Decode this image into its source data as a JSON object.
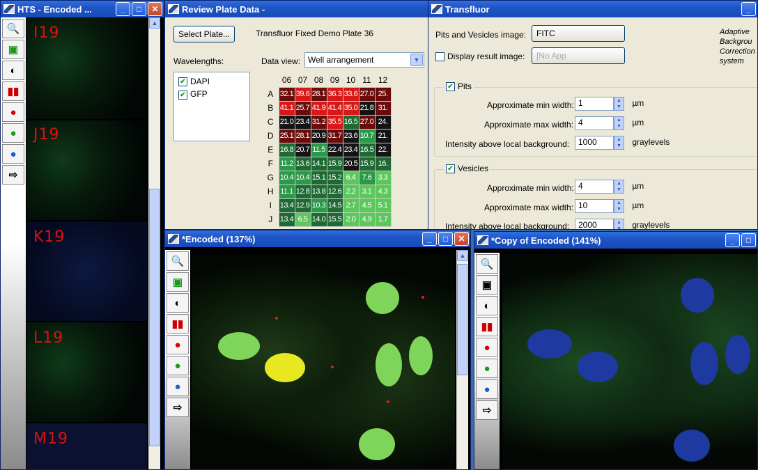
{
  "hts_window": {
    "title": "HTS - Encoded ...",
    "wells": [
      "I19",
      "J19",
      "K19",
      "L19",
      "M19"
    ]
  },
  "review_window": {
    "title": "Review Plate Data -",
    "select_plate_label": "Select Plate...",
    "plate_name": "Transfluor Fixed Demo Plate 36",
    "wavelengths_label": "Wavelengths:",
    "wavelengths": [
      "DAPI",
      "GFP"
    ],
    "data_view_label": "Data view:",
    "data_view_value": "Well arrangement",
    "columns": [
      "06",
      "07",
      "08",
      "09",
      "10",
      "11",
      "12"
    ],
    "rows": [
      {
        "label": "A",
        "values": [
          "32.1",
          "39.6",
          "28.1",
          "36.3",
          "33.6",
          "27.0",
          "25."
        ]
      },
      {
        "label": "B",
        "values": [
          "41.1",
          "25.7",
          "41.9",
          "41.4",
          "35.0",
          "21.8",
          "31."
        ]
      },
      {
        "label": "C",
        "values": [
          "21.0",
          "23.4",
          "31.2",
          "35.5",
          "16.5",
          "27.0",
          "24."
        ]
      },
      {
        "label": "D",
        "values": [
          "25.1",
          "28.1",
          "20.9",
          "31.7",
          "23.6",
          "10.7",
          "21."
        ]
      },
      {
        "label": "E",
        "values": [
          "16.8",
          "20.7",
          "11.5",
          "22.4",
          "23.4",
          "16.5",
          "22."
        ]
      },
      {
        "label": "F",
        "values": [
          "11.2",
          "13.6",
          "14.1",
          "15.9",
          "20.5",
          "15.9",
          "16."
        ]
      },
      {
        "label": "G",
        "values": [
          "10.4",
          "10.4",
          "15.1",
          "15.2",
          "6.4",
          "7.6",
          "3.3"
        ]
      },
      {
        "label": "H",
        "values": [
          "11.1",
          "12.8",
          "13.8",
          "12.6",
          "2.2",
          "3.1",
          "4.3"
        ]
      },
      {
        "label": "I",
        "values": [
          "13.4",
          "12.9",
          "10.3",
          "14.5",
          "2.7",
          "4.5",
          "5.1"
        ]
      },
      {
        "label": "J",
        "values": [
          "13.4",
          "6.5",
          "14.0",
          "15.5",
          "2.0",
          "4.9",
          "1.7"
        ]
      }
    ]
  },
  "transfluor_window": {
    "title": "Transfluor",
    "pits_vesicles_label": "Pits and Vesicles image:",
    "pits_vesicles_value": "FITC",
    "display_result_label": "Display result image:",
    "display_result_value": "[No App",
    "adaptive_text": "Adaptive Backgrou Correction system",
    "pits": {
      "label": "Pits",
      "min_label": "Approximate min width:",
      "min_value": "1",
      "max_label": "Approximate max width:",
      "max_value": "4",
      "unit": "µm",
      "intensity_label": "Intensity above local background:",
      "intensity_value": "1000",
      "intensity_unit": "graylevels"
    },
    "vesicles": {
      "label": "Vesicles",
      "min_label": "Approximate min width:",
      "min_value": "4",
      "max_label": "Approximate max width:",
      "max_value": "10",
      "unit": "µm",
      "intensity_label": "Intensity above local background:",
      "intensity_value": "2000",
      "intensity_unit": "graylevels"
    }
  },
  "encoded_window": {
    "title": "*Encoded (137%)"
  },
  "copy_window": {
    "title": "*Copy of Encoded (141%)"
  },
  "colors": {
    "red_high": "#d01818",
    "black": "#111111",
    "green": "#1e9e3a",
    "titlebar": "#1f54c6"
  }
}
